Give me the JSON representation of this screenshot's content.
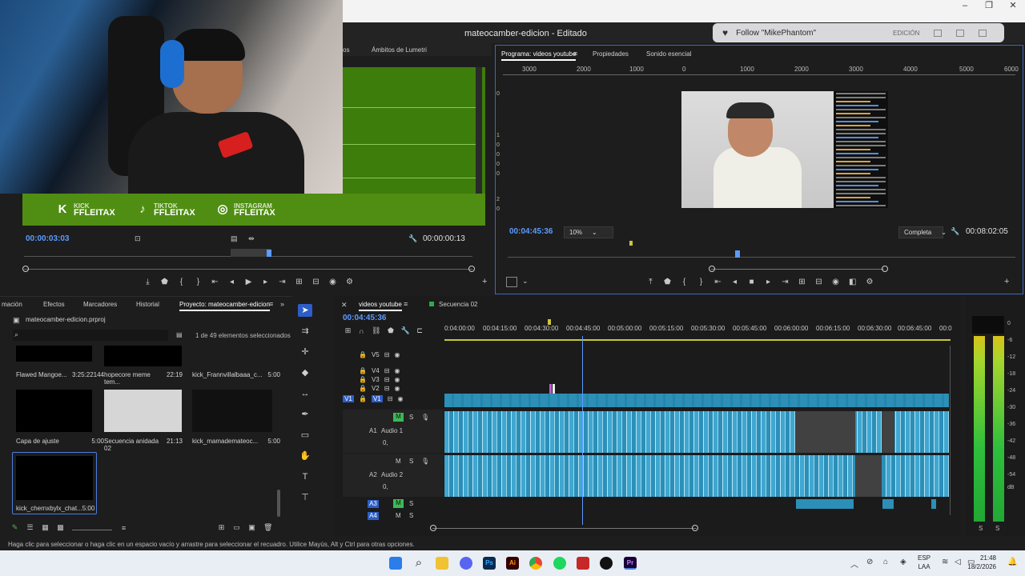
{
  "window": {
    "title": "mateocamber-edicion - Editado",
    "minimize": "–",
    "maximize": "❐",
    "close": "✕"
  },
  "follow_popup": {
    "text": "Follow \"MikePhantom\"",
    "workspace": "EDICIÓN"
  },
  "webcam": {
    "social": [
      {
        "icon": "kick-icon",
        "glyph": "K",
        "site": "KICK",
        "handle": "FFLEITAX"
      },
      {
        "icon": "tiktok-icon",
        "glyph": "♪",
        "site": "TIKTOK",
        "handle": "FFLEITAX"
      },
      {
        "icon": "instagram-icon",
        "glyph": "◎",
        "site": "INSTAGRAM",
        "handle": "FFLEITAX"
      }
    ]
  },
  "source_monitor": {
    "tab_partial": "os",
    "tab_lumetri": "Ámbitos de Lumetri",
    "timecode_in": "00:00:03:03",
    "timecode_duration": "00:00:00:13"
  },
  "program_monitor": {
    "tabs": [
      "Programa: videos youtube",
      "Propiedades",
      "Sonido esencial"
    ],
    "ruler": [
      "3000",
      "2000",
      "1000",
      "0",
      "1000",
      "2000",
      "3000",
      "4000",
      "5000",
      "6000"
    ],
    "side_ruler": [
      "0",
      "1",
      "0",
      "0",
      "0",
      "0",
      "2",
      "0"
    ],
    "timecode": "00:04:45:36",
    "zoom": "10%",
    "quality": "Completa",
    "duration": "00:08:02:05"
  },
  "project_panel": {
    "tabs": [
      "mación",
      "Efectos",
      "Marcadores",
      "Historial",
      "Proyecto: mateocamber-edicion"
    ],
    "file": "mateocamber-edicion.prproj",
    "selection": "1 de 49 elementos seleccionados",
    "items": [
      {
        "name": "Flawed Mangoe...",
        "duration": "3:25:22144"
      },
      {
        "name": "hopecore meme tem...",
        "duration": "22:19"
      },
      {
        "name": "kick_Frannvillalbaaa_c...",
        "duration": "5:00"
      },
      {
        "name": "Capa de ajuste",
        "duration": "5:00"
      },
      {
        "name": "Secuencia anidada 02",
        "duration": "21:13"
      },
      {
        "name": "kick_mamademateoc...",
        "duration": "5:00"
      },
      {
        "name": "kick_chernxbylx_chat...",
        "duration": "5:00"
      }
    ]
  },
  "timeline": {
    "tabs": [
      "videos youtube",
      "Secuencia 02"
    ],
    "timecode": "00:04:45:36",
    "ruler": [
      "0:04:00:00",
      "00:04:15:00",
      "00:04:30:00",
      "00:04:45:00",
      "00:05:00:00",
      "00:05:15:00",
      "00:05:30:00",
      "00:05:45:00",
      "00:06:00:00",
      "00:06:15:00",
      "00:06:30:00",
      "00:06:45:00",
      "00:0"
    ],
    "video_tracks": [
      "V5",
      "V4",
      "V3",
      "V2",
      "V1"
    ],
    "audio_tracks": [
      {
        "id": "A1",
        "name": "Audio 1"
      },
      {
        "id": "A2",
        "name": "Audio 2"
      },
      {
        "id": "A3",
        "name": ""
      },
      {
        "id": "A4",
        "name": ""
      }
    ],
    "mute": "M",
    "solo": "S",
    "level": "0,"
  },
  "meter": {
    "scale": [
      "0",
      "-6",
      "-12",
      "-18",
      "-24",
      "-30",
      "-36",
      "-42",
      "-48",
      "-54",
      "dB"
    ],
    "footer": [
      "S",
      "S"
    ]
  },
  "status_bar": "Haga clic para seleccionar o haga clic en un espacio vacío y arrastre para seleccionar el recuadro. Utilice Mayús, Alt y Ctrl para otras opciones.",
  "taskbar": {
    "lang1": "ESP",
    "lang2": "LAA",
    "time": "21:48",
    "date": "18/2/2026"
  }
}
